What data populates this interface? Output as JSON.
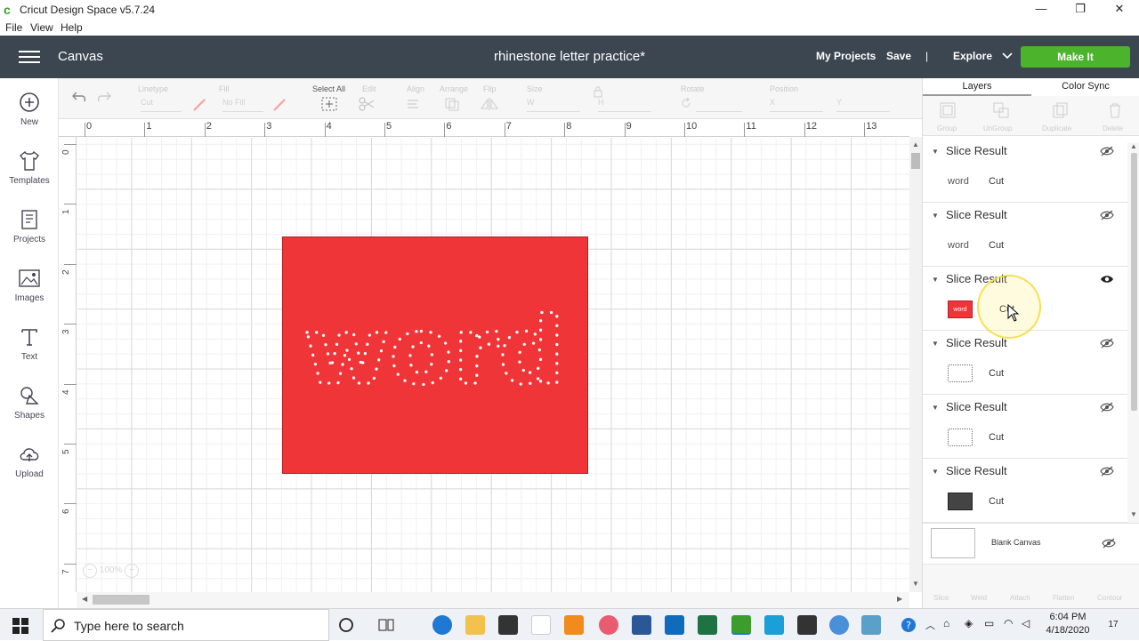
{
  "window": {
    "title": "Cricut Design Space  v5.7.24",
    "controls": [
      "—",
      "❐",
      "✕"
    ]
  },
  "menu": [
    "File",
    "View",
    "Help"
  ],
  "header": {
    "canvas_label": "Canvas",
    "doc_title": "rhinestone letter practice*",
    "my_projects": "My Projects",
    "save": "Save",
    "separator": "|",
    "explore": "Explore",
    "make_it": "Make It"
  },
  "sidebar": [
    {
      "label": "New",
      "icon": "plus-circle-icon"
    },
    {
      "label": "Templates",
      "icon": "tshirt-icon"
    },
    {
      "label": "Projects",
      "icon": "projects-icon"
    },
    {
      "label": "Images",
      "icon": "image-icon"
    },
    {
      "label": "Text",
      "icon": "text-icon"
    },
    {
      "label": "Shapes",
      "icon": "shapes-icon"
    },
    {
      "label": "Upload",
      "icon": "upload-icon"
    }
  ],
  "toolbar": {
    "linetype_label": "Linetype",
    "linetype_value": "Cut",
    "fill_label": "Fill",
    "fill_value": "No Fill",
    "select_all": "Select All",
    "edit": "Edit",
    "align": "Align",
    "arrange": "Arrange",
    "flip": "Flip",
    "size": "Size",
    "size_w": "W",
    "size_h": "H",
    "rotate": "Rotate",
    "position": "Position",
    "pos_x": "X",
    "pos_y": "Y"
  },
  "ruler": {
    "h": [
      "0",
      "1",
      "2",
      "3",
      "4",
      "5",
      "6",
      "7",
      "8",
      "9",
      "10",
      "11",
      "12",
      "13"
    ],
    "v": [
      "0",
      "1",
      "2",
      "3",
      "4",
      "5",
      "6",
      "7"
    ]
  },
  "canvas": {
    "word": "word",
    "zoom": "100%",
    "design_color": "#f03538"
  },
  "panel": {
    "tabs": [
      "Layers",
      "Color Sync"
    ],
    "tools": [
      "Group",
      "UnGroup",
      "Duplicate",
      "Delete"
    ],
    "layers": [
      {
        "name": "Slice Result",
        "thumb": "word",
        "op": "Cut",
        "visible": false
      },
      {
        "name": "Slice Result",
        "thumb": "word",
        "op": "Cut",
        "visible": false
      },
      {
        "name": "Slice Result",
        "thumb": "word",
        "op": "Cut",
        "visible": true
      },
      {
        "name": "Slice Result",
        "thumb": "",
        "op": "Cut",
        "visible": false
      },
      {
        "name": "Slice Result",
        "thumb": "",
        "op": "Cut",
        "visible": false
      },
      {
        "name": "Slice Result",
        "thumb": "",
        "op": "Cut",
        "visible": false
      }
    ],
    "blank_canvas": "Blank Canvas",
    "bottom_tools": [
      "Slice",
      "Weld",
      "Attach",
      "Flatten",
      "Contour"
    ]
  },
  "taskbar": {
    "search_placeholder": "Type here to search",
    "time": "6:04 PM",
    "date": "4/18/2020",
    "notifications": "17"
  }
}
